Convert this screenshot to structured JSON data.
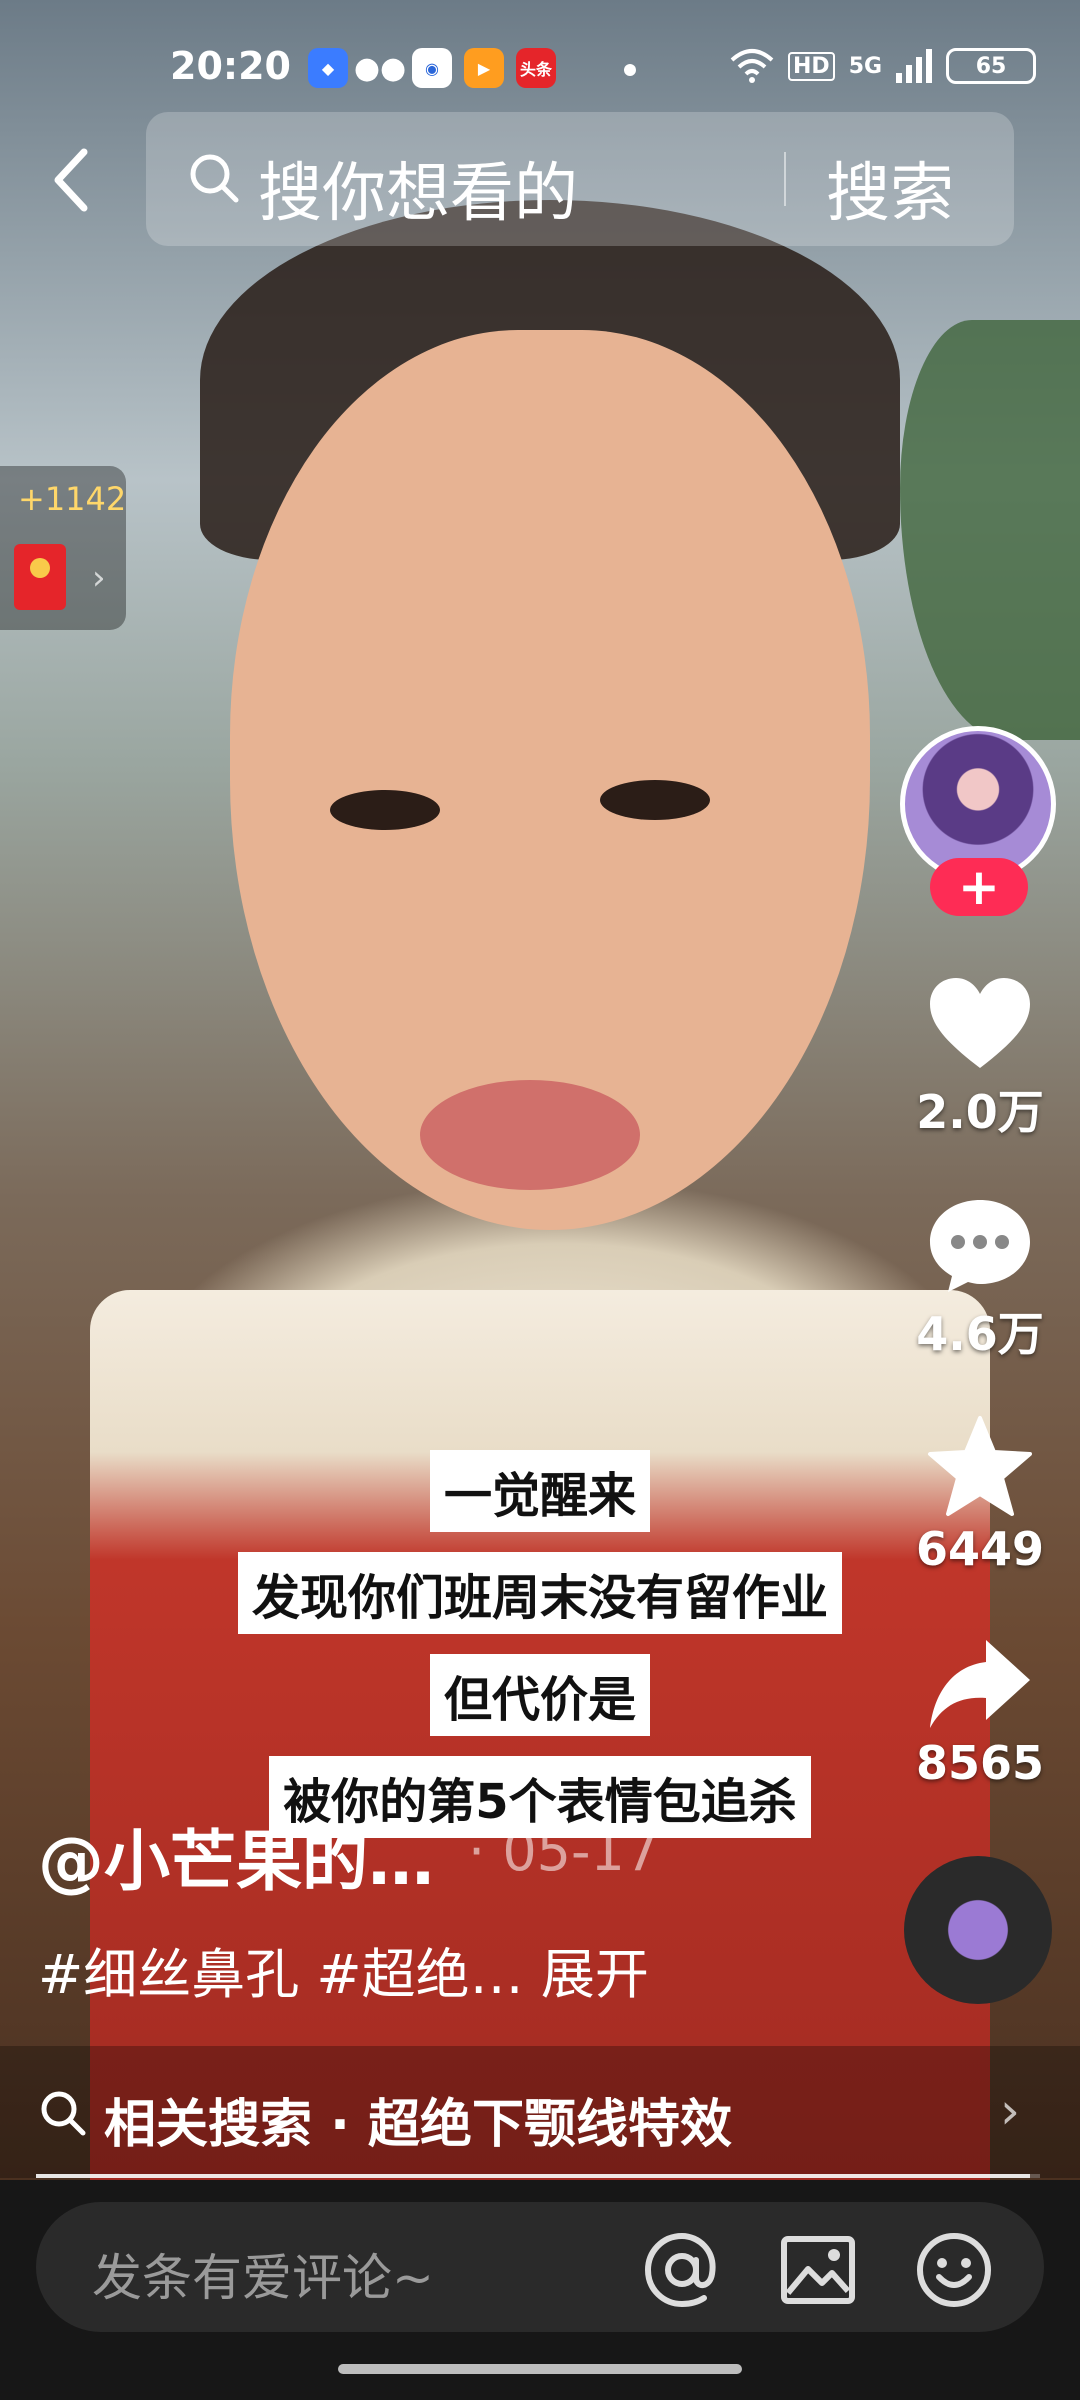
{
  "status_bar": {
    "time": "20:20",
    "app_icons": [
      "notification-app-1",
      "wechat",
      "news-app",
      "video-app",
      "toutiao"
    ],
    "toutiao_label": "头条",
    "network": "HD",
    "signal": "5G",
    "battery": "65"
  },
  "search": {
    "placeholder": "搜你想看的",
    "button": "搜索"
  },
  "red_packet": {
    "count": "+1142"
  },
  "rail": {
    "follow_symbol": "+",
    "likes": "2.0万",
    "comments": "4.6万",
    "favorites": "6449",
    "shares": "8565"
  },
  "caption": {
    "lines": [
      "一觉醒来",
      "发现你们班周末没有留作业",
      "但代价是",
      "被你的第5个表情包追杀"
    ]
  },
  "post": {
    "author": "@小芒果的…",
    "time": "· 05-17",
    "description": "#细丝鼻孔 #超绝… 展开"
  },
  "related_search": {
    "text": "相关搜索 · 超绝下颚线特效"
  },
  "progress": 0.99,
  "comment_bar": {
    "placeholder": "发条有爱评论~"
  },
  "colors": {
    "accent": "#fe2c55",
    "bar_bg": "#171717"
  }
}
